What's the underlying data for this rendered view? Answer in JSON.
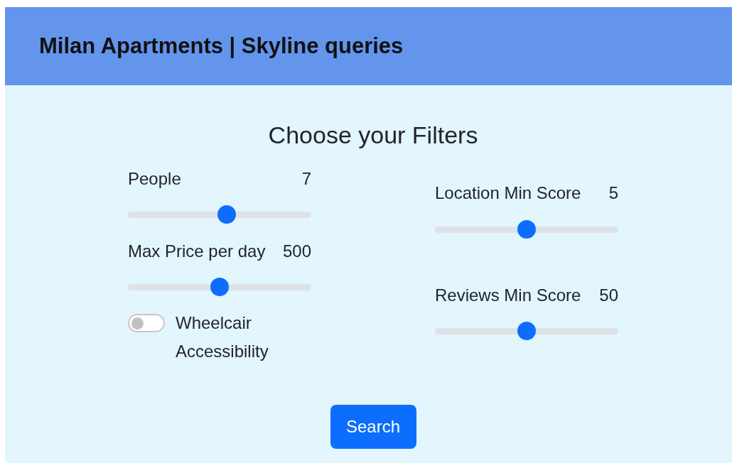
{
  "header": {
    "title": "Milan Apartments | Skyline queries"
  },
  "heading": "Choose your Filters",
  "left_filters": [
    {
      "label": "People",
      "value": "7",
      "level": 0.54
    },
    {
      "label": "Max Price per day",
      "value": "500",
      "level": 0.5
    }
  ],
  "accessibility_switch": {
    "label": "Wheelcair Accessibility",
    "on": false
  },
  "right_filters": [
    {
      "label": "Location Min Score",
      "value": "5",
      "level": 0.5
    },
    {
      "label": "Reviews Min Score",
      "value": "50",
      "level": 0.5
    }
  ],
  "search_button": "Search"
}
